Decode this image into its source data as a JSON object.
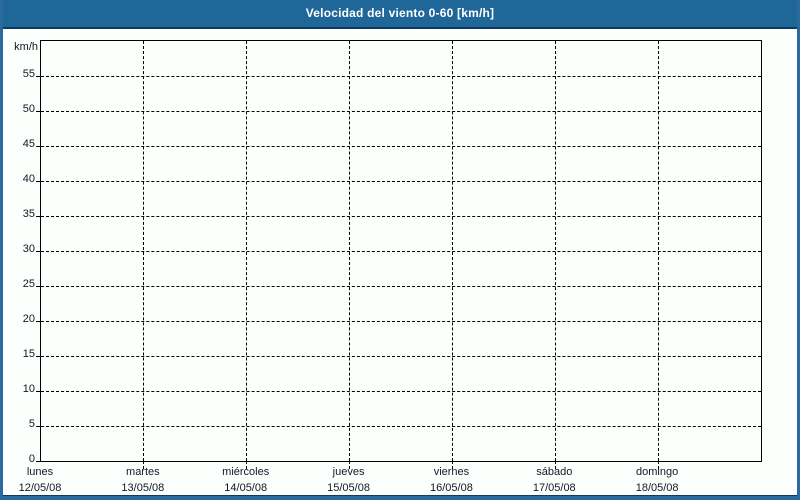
{
  "header": {
    "title": "Velocidad del viento 0-60 [km/h]"
  },
  "colors": {
    "header_bg": "#1f6699",
    "header_text": "#ffffff",
    "panel_border": "#2a6a9e",
    "dark_line": "#0d3c5f",
    "page_bg": "#fdfffd",
    "axis": "#000000",
    "grid": "#000000",
    "label_text": "#0c1a26"
  },
  "chart_data": {
    "type": "line",
    "title": "Velocidad del viento 0-60 [km/h]",
    "ylabel": "km/h",
    "xlabel": "",
    "ylim": [
      0,
      60
    ],
    "ytick_values": [
      0,
      5,
      10,
      15,
      20,
      25,
      30,
      35,
      40,
      45,
      50,
      55
    ],
    "grid": "dashed",
    "legend": "none",
    "categories": [
      {
        "day": "lunes",
        "date": "12/05/08"
      },
      {
        "day": "martes",
        "date": "13/05/08"
      },
      {
        "day": "miércoles",
        "date": "14/05/08"
      },
      {
        "day": "jueves",
        "date": "15/05/08"
      },
      {
        "day": "viernes",
        "date": "16/05/08"
      },
      {
        "day": "sábado",
        "date": "17/05/08"
      },
      {
        "day": "domingo",
        "date": "18/05/08"
      }
    ],
    "series": []
  }
}
